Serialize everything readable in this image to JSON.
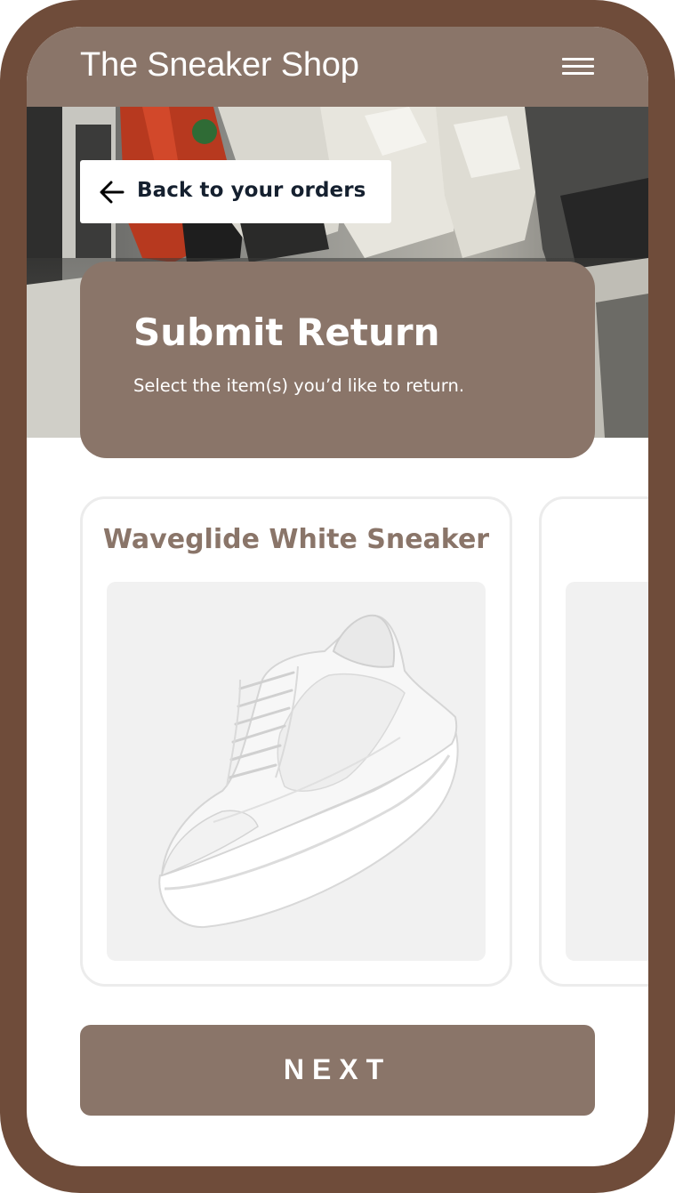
{
  "app": {
    "title": "The Sneaker Shop",
    "menu_icon": "hamburger-menu-icon"
  },
  "navigation": {
    "back_label": "Back to your orders",
    "back_icon": "arrow-left-icon"
  },
  "return_panel": {
    "title": "Submit Return",
    "subtitle": "Select the item(s) you’d like to return."
  },
  "products": [
    {
      "name": "Waveglide White Sneaker"
    },
    {
      "name": ""
    }
  ],
  "actions": {
    "next_label": "NEXT"
  },
  "colors": {
    "frame": "#6f4c3a",
    "brand": "#8a7569",
    "text_dark": "#15202f",
    "card_border": "#ececec",
    "image_bg": "#f1f1f1"
  }
}
